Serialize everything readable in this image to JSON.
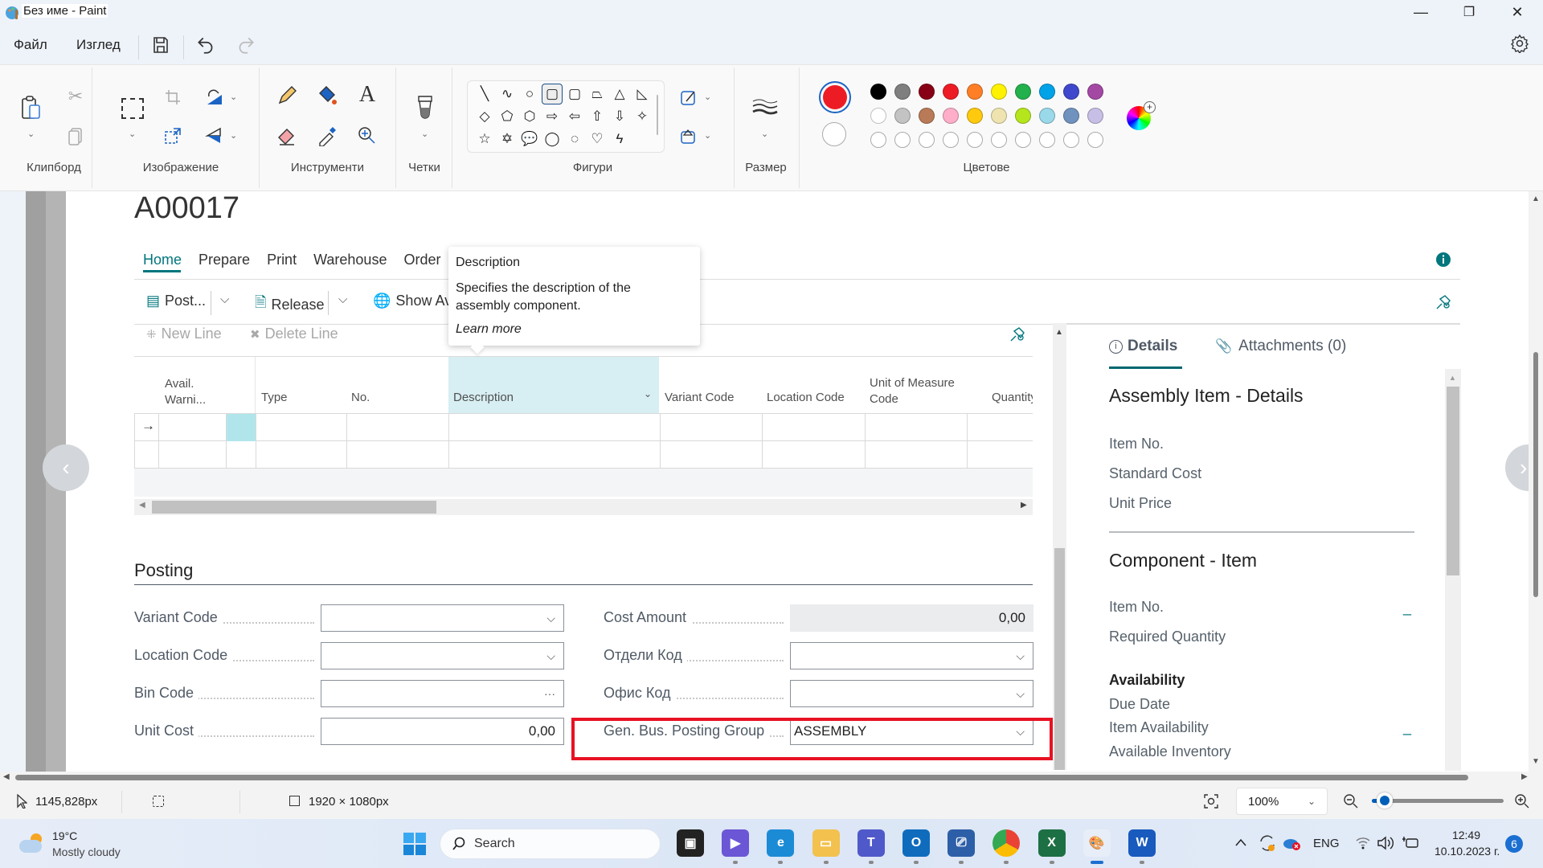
{
  "window": {
    "title": "Без име - Paint",
    "minimize": "—",
    "maximize": "❐",
    "close": "✕"
  },
  "menu": {
    "file": "Файл",
    "view": "Изглед",
    "save_icon": "save-icon",
    "undo_icon": "undo-icon",
    "redo_icon": "redo-icon",
    "settings_icon": "gear-icon"
  },
  "ribbon": {
    "groups": {
      "clipboard": "Клипборд",
      "image": "Изображение",
      "tools": "Инструменти",
      "brushes": "Четки",
      "shapes": "Фигури",
      "size": "Размер",
      "colors": "Цветове"
    },
    "primary_color": "#ed1c24",
    "secondary_color": "#ffffff",
    "palette_row1": [
      "#000000",
      "#7f7f7f",
      "#880015",
      "#ed1c24",
      "#ff7f27",
      "#fff200",
      "#22b14c",
      "#00a2e8",
      "#3f48cc",
      "#a349a4"
    ],
    "palette_row2": [
      "#ffffff",
      "#c3c3c3",
      "#b97a57",
      "#ffaec9",
      "#ffc90e",
      "#efe4b0",
      "#b5e61d",
      "#99d9ea",
      "#7092be",
      "#c8bfe7"
    ],
    "shapes": [
      "╲",
      "∿",
      "○",
      "▢",
      "▢",
      "⏢",
      "△",
      "◺",
      "◇",
      "⬠",
      "⬡",
      "⇨",
      "⇦",
      "⇧",
      "⇩",
      "✧",
      "☆",
      "✡",
      "💬",
      "◯",
      "◌",
      "♡",
      "ϟ"
    ]
  },
  "bc": {
    "record_no": "A00017",
    "tabs": [
      "Home",
      "Prepare",
      "Print",
      "Warehouse",
      "Order"
    ],
    "actions": {
      "post": "Post...",
      "release": "Release",
      "show_av": "Show Av"
    },
    "line_actions": {
      "new_line": "New Line",
      "delete_line": "Delete Line"
    },
    "tooltip": {
      "title": "Description",
      "body": "Specifies the description of the assembly component.",
      "link": "Learn more"
    },
    "grid": {
      "columns": [
        "Avail. Warni...",
        "Type",
        "No.",
        "Description",
        "Variant Code",
        "Location Code",
        "Unit of Measure Code",
        "Quantity"
      ],
      "row_marker": "→"
    },
    "posting": {
      "title": "Posting",
      "left_fields": [
        {
          "label": "Variant Code",
          "value": "",
          "control": "dropdown"
        },
        {
          "label": "Location Code",
          "value": "",
          "control": "dropdown"
        },
        {
          "label": "Bin Code",
          "value": "",
          "control": "lookup"
        },
        {
          "label": "Unit Cost",
          "value": "0,00",
          "control": "text"
        }
      ],
      "right_fields": [
        {
          "label": "Cost Amount",
          "value": "0,00",
          "control": "readonly"
        },
        {
          "label": "Отдели Код",
          "value": "",
          "control": "dropdown"
        },
        {
          "label": "Офис Код",
          "value": "",
          "control": "dropdown"
        },
        {
          "label": "Gen. Bus. Posting Group",
          "value": "ASSEMBLY",
          "control": "dropdown"
        }
      ]
    },
    "factbox": {
      "tab_details": "Details",
      "tab_attachments": "Attachments (0)",
      "section1_title": "Assembly Item - Details",
      "section1_fields": [
        "Item No.",
        "Standard Cost",
        "Unit Price"
      ],
      "section2_title": "Component - Item",
      "section2_fields": [
        "Item No.",
        "Required Quantity"
      ],
      "item_no_value": "_",
      "availability_title": "Availability",
      "availability_fields": [
        "Due Date",
        "Item Availability",
        "Available Inventory"
      ],
      "item_availability_value": "_"
    },
    "highlight_color": "#e81123"
  },
  "statusbar": {
    "cursor_pos": "1145,828px",
    "canvas_size": "1920 × 1080px",
    "zoom": "100%",
    "zoom_fraction": 0.1
  },
  "taskbar": {
    "weather_temp": "19°C",
    "weather_desc": "Mostly cloudy",
    "search_placeholder": "Search",
    "language": "ENG",
    "time": "12:49",
    "date": "10.10.2023 г.",
    "notifications": "6",
    "apps": [
      "Task View",
      "Clipchamp",
      "Edge",
      "File Explorer",
      "Teams",
      "Outlook",
      "Remote Desktop",
      "Chrome",
      "Excel",
      "Paint",
      "Word"
    ]
  }
}
